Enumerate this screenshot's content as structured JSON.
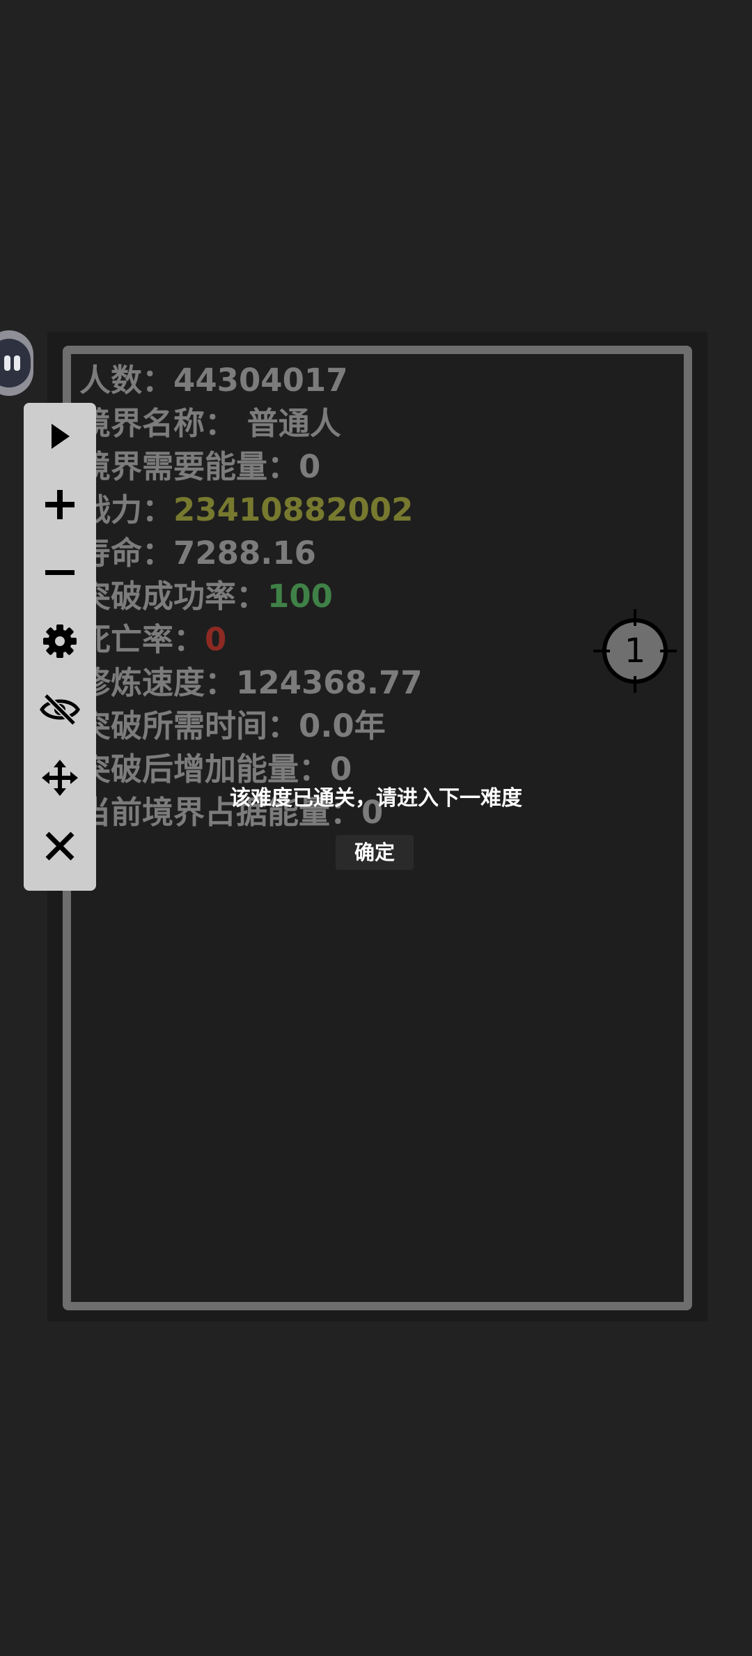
{
  "stats": {
    "population": {
      "label": "人数：",
      "value": "44304017"
    },
    "realm_name": {
      "label": "境界名称：",
      "value": "普通人"
    },
    "realm_energy_required": {
      "label": "境界需要能量：",
      "value": "0"
    },
    "combat_power": {
      "label": "战力：",
      "value": "23410882002",
      "color": "#77792f"
    },
    "lifespan": {
      "label": "寿命：",
      "value": "7288.16"
    },
    "breakthrough_success_rate": {
      "label": "突破成功率：",
      "value": "100",
      "color": "#3f8147"
    },
    "death_rate": {
      "label": "死亡率：",
      "value": "0",
      "color": "#8c2a23"
    },
    "cultivation_speed": {
      "label": "修炼速度：",
      "value": "124368.77"
    },
    "breakthrough_time": {
      "label": "突破所需时间：",
      "value": "0.0年"
    },
    "energy_gain_after_breakthrough": {
      "label": "突破后增加能量：",
      "value": "0"
    },
    "current_realm_energy_share": {
      "label": "当前境界占据能量：",
      "value": "0"
    }
  },
  "toolbar": {
    "icons": [
      "play-icon",
      "plus-icon",
      "minus-icon",
      "gear-icon",
      "eye-off-icon",
      "move-icon",
      "close-icon"
    ]
  },
  "target_marker": {
    "number": "1"
  },
  "dialog": {
    "message": "该难度已通关，请进入下一难度",
    "confirm_label": "确定"
  },
  "colors": {
    "background": "#222222",
    "panel": "#1e1e1e",
    "frame": "#6e6e6e",
    "text": "#7c7c7c",
    "toolbar": "#cdcdcd"
  }
}
